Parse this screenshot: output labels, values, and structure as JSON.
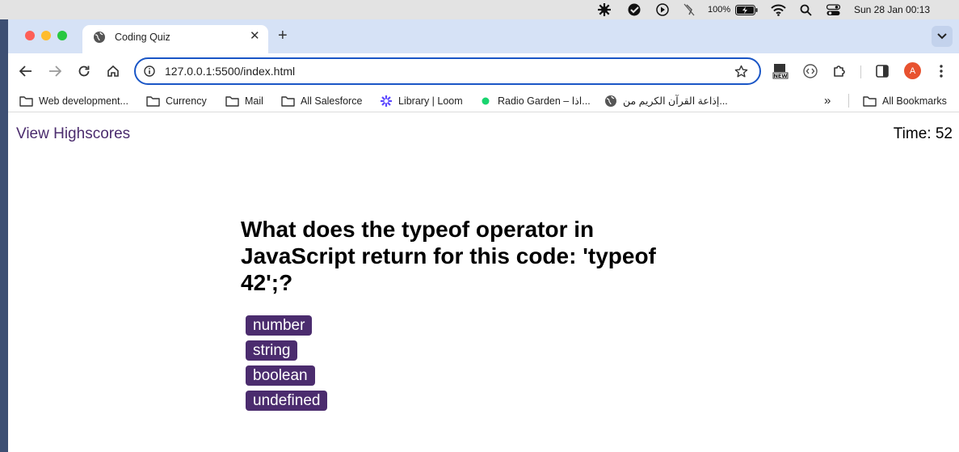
{
  "menubar": {
    "battery": "100%",
    "clock": "Sun 28 Jan  00:13"
  },
  "browser": {
    "tab_title": "Coding Quiz",
    "url": "127.0.0.1:5500/index.html",
    "avatar_letter": "A",
    "new_badge": "NEW"
  },
  "bookmarks": [
    {
      "label": "Web development...",
      "icon": "folder-icon"
    },
    {
      "label": "Currency",
      "icon": "folder-icon"
    },
    {
      "label": "Mail",
      "icon": "folder-icon"
    },
    {
      "label": "All Salesforce",
      "icon": "folder-icon"
    },
    {
      "label": "Library | Loom",
      "icon": "loom-icon"
    },
    {
      "label": "Radio Garden – اذا...",
      "icon": "radio-dot-icon"
    },
    {
      "label": "إذاعة القرآن الكريم من...",
      "icon": "globe-icon"
    }
  ],
  "all_bookmarks": "All Bookmarks",
  "quiz": {
    "highscores_link": "View Highscores",
    "timer": "Time: 52",
    "question": "What does the typeof operator in JavaScript return for this code: 'typeof 42';?",
    "answers": [
      "number",
      "string",
      "boolean",
      "undefined"
    ]
  },
  "colors": {
    "accent": "#4b2c6e",
    "omnibox_border": "#1a56c6",
    "tabstrip": "#d6e2f6"
  }
}
